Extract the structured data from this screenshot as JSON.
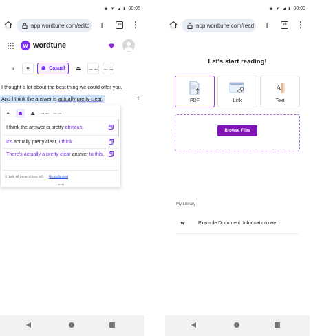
{
  "left": {
    "status": {
      "time": "08:05"
    },
    "browser": {
      "url": "app.wordtune.com/edito",
      "tab_count": "10"
    },
    "app": {
      "logo_letter": "w",
      "name": "wordtune"
    },
    "toolbar": {
      "expand_label": "»",
      "casual_label": "Casual"
    },
    "editor": {
      "line1_before": "I thought a lot about the ",
      "line1_underlined": "best",
      "line1_after": " thing we could offer you.",
      "line2_before": "And I think the answer is ",
      "line2_underlined": "actually pretty clear",
      "line2_after": "."
    },
    "suggestions": [
      {
        "parts": [
          "I think the answer is pretty ",
          "obvious",
          "."
        ]
      },
      {
        "parts": [
          "",
          "It's",
          " actually pretty clear",
          ", I think",
          "."
        ]
      },
      {
        "parts": [
          "There's actually a pretty clear",
          " answer ",
          "to this",
          "."
        ]
      }
    ],
    "footer": {
      "generations_left": "3 daily AI generations left",
      "unlimited_link": "Go unlimited"
    }
  },
  "right": {
    "status": {
      "time": "08:09"
    },
    "browser": {
      "url": "app.wordtune.com/read",
      "tab_count": "10"
    },
    "heading": "Let's start reading!",
    "sources": [
      {
        "label": "PDF",
        "icon": "pdf-icon"
      },
      {
        "label": "Link",
        "icon": "link-icon"
      },
      {
        "label": "Text",
        "icon": "text-icon"
      }
    ],
    "browse_label": "Browse Files",
    "library": {
      "heading": "My Library",
      "items": [
        {
          "icon_letter": "W",
          "title": "Example Document: Information ove..."
        }
      ]
    }
  },
  "colors": {
    "brand": "#7b2ff0",
    "browse_button": "#7e13b8",
    "selection": "#cfe3fb"
  }
}
